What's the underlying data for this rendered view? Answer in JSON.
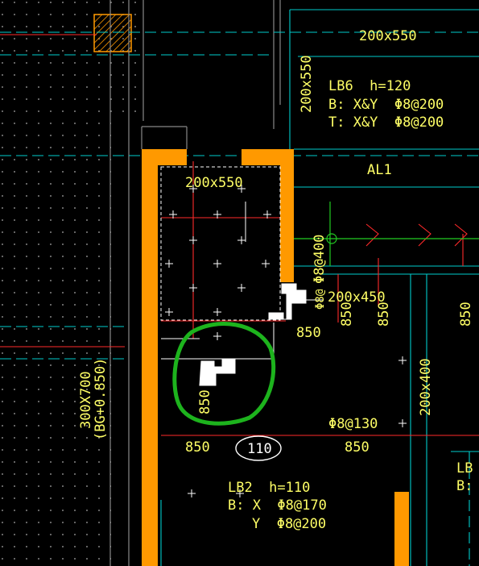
{
  "drawing": {
    "beam_top_label": "200x550",
    "beam_top_vertical_label": "200x550",
    "slab_lb6": {
      "name_line": "LB6  h=120",
      "bottom_line": "B: X&Y  Φ8@200",
      "top_line": "T: X&Y  Φ8@200"
    },
    "beam_al1_label": "AL1",
    "inner_beam_label": "200x550",
    "rebar_vertical_label": "Φ8@400",
    "beam_200x450_label": "200x450",
    "small_vertical_label": "Φ8@",
    "dim_850_vertical_a": "850",
    "dim_850_vertical_b": "850",
    "dim_850_vertical_c": "850",
    "dim_850_right_of_opening": "850",
    "dim_850_circled": "850",
    "beam_300x700_line1": "300X700",
    "beam_300x700_line2": "(BG+0.850)",
    "beam_200x400_label": "200x400",
    "rebar_phi8_130": "Φ8@130",
    "dim_850_bottom_left": "850",
    "dim_850_bottom_mid": "850",
    "room_number": "110",
    "slab_lb2": {
      "name_line": "LB2  h=110",
      "x_line": "B: X  Φ8@170",
      "y_line": "Y  Φ8@200"
    },
    "slab_lb_right_top": "LB",
    "slab_lb_right_bottom": "B:"
  },
  "colors": {
    "background": "#000000",
    "wall_fill": "#ff9900",
    "text_yellow": "#ffff66",
    "cyan_line": "#00cccc",
    "red_line": "#ff2a2a",
    "green_markup": "#1db31d",
    "dot_pattern": "#bbbbbb",
    "white": "#ffffff"
  }
}
